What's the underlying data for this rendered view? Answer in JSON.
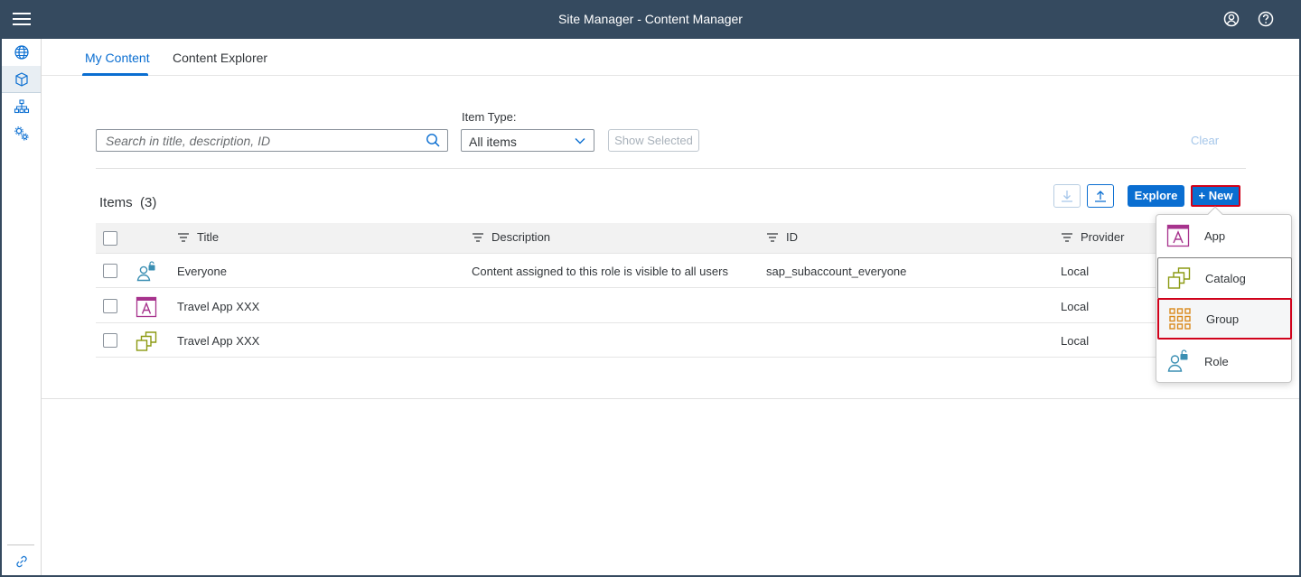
{
  "shell": {
    "title": "Site Manager - Content Manager"
  },
  "tabs": [
    {
      "label": "My Content",
      "active": true
    },
    {
      "label": "Content Explorer",
      "active": false
    }
  ],
  "filters": {
    "search_placeholder": "Search in title, description, ID",
    "item_type_label": "Item Type:",
    "item_type_value": "All items",
    "show_selected_label": "Show Selected",
    "clear_label": "Clear"
  },
  "items": {
    "title": "Items",
    "count": "(3)",
    "explore_label": "Explore",
    "new_label": "+ New"
  },
  "table": {
    "columns": [
      "Title",
      "Description",
      "ID",
      "Provider"
    ],
    "rows": [
      {
        "icon": "role-icon",
        "title": "Everyone",
        "description": "Content assigned to this role is visible to all users",
        "id": "sap_subaccount_everyone",
        "provider": "Local"
      },
      {
        "icon": "app-icon",
        "title": "Travel App XXX",
        "description": "",
        "id": "",
        "provider": "Local"
      },
      {
        "icon": "catalog-icon",
        "title": "Travel App XXX",
        "description": "",
        "id": "",
        "provider": "Local"
      }
    ]
  },
  "new_menu": {
    "items": [
      {
        "label": "App",
        "icon": "app-icon"
      },
      {
        "label": "Catalog",
        "icon": "catalog-icon"
      },
      {
        "label": "Group",
        "icon": "group-icon"
      },
      {
        "label": "Role",
        "icon": "role-icon"
      }
    ]
  },
  "colors": {
    "shell": "#354a5f",
    "accent": "#0a6ed1",
    "app_icon": "#a7338d",
    "catalog_icon": "#8c9a12",
    "group_icon": "#d9891c",
    "role_icon": "#3b8fb3",
    "highlight_border": "#d0021b"
  }
}
